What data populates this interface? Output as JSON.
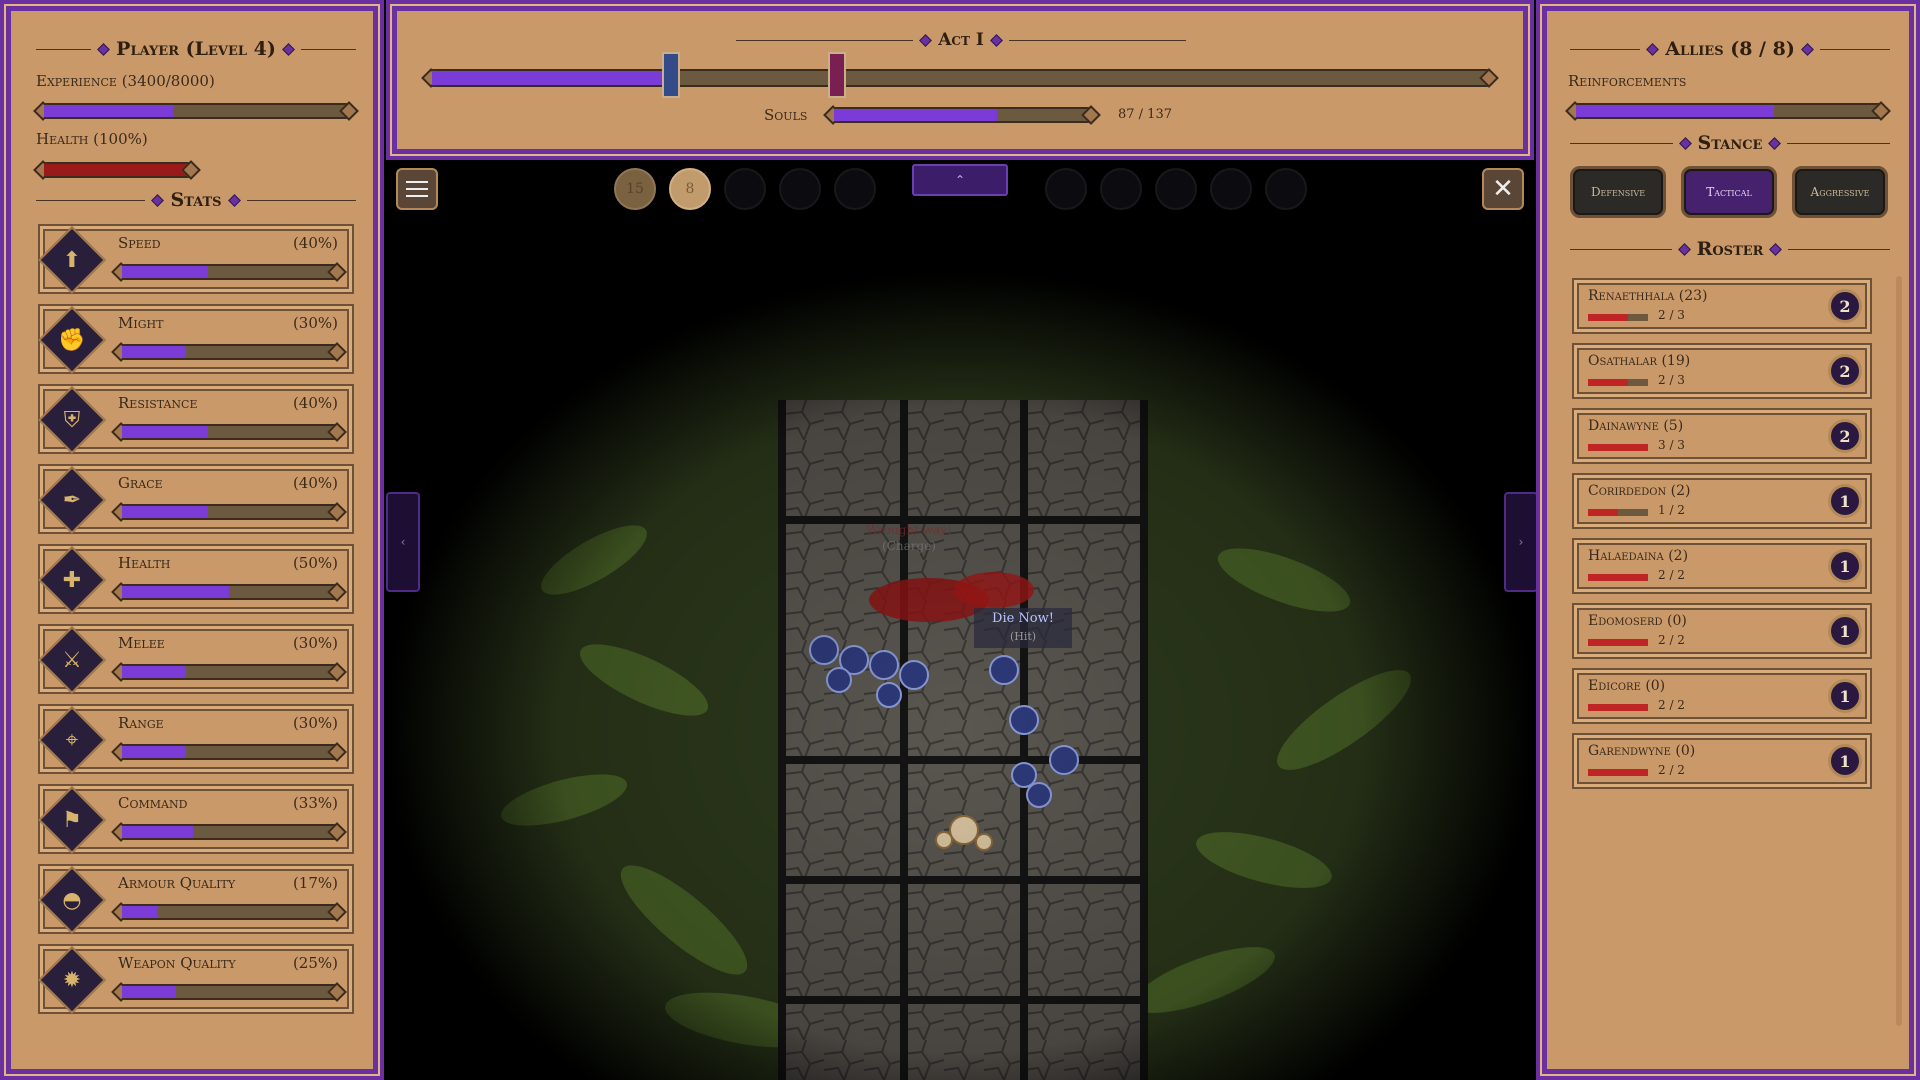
{
  "player": {
    "title": "Player (Level 4)",
    "experience_label": "Experience (3400/8000)",
    "experience_fraction": 0.425,
    "health_label": "Health (100%)",
    "health_fraction": 1.0
  },
  "stats": {
    "title": "Stats",
    "items": [
      {
        "name": "Speed",
        "pct": "(40%)",
        "value": 0.4,
        "icon": "boot-icon"
      },
      {
        "name": "Might",
        "pct": "(30%)",
        "value": 0.3,
        "icon": "flexed-arm-icon"
      },
      {
        "name": "Resistance",
        "pct": "(40%)",
        "value": 0.4,
        "icon": "shield-icon"
      },
      {
        "name": "Grace",
        "pct": "(40%)",
        "value": 0.4,
        "icon": "winged-feather-icon"
      },
      {
        "name": "Health",
        "pct": "(50%)",
        "value": 0.5,
        "icon": "cross-icon"
      },
      {
        "name": "Melee",
        "pct": "(30%)",
        "value": 0.3,
        "icon": "crossed-swords-icon"
      },
      {
        "name": "Range",
        "pct": "(30%)",
        "value": 0.3,
        "icon": "crosshair-icon"
      },
      {
        "name": "Command",
        "pct": "(33%)",
        "value": 0.33,
        "icon": "banner-icon"
      },
      {
        "name": "Armour Quality",
        "pct": "(17%)",
        "value": 0.17,
        "icon": "helmet-icon"
      },
      {
        "name": "Weapon Quality",
        "pct": "(25%)",
        "value": 0.25,
        "icon": "star-burst-icon"
      }
    ]
  },
  "act": {
    "title": "Act I",
    "progress_fraction": 0.23,
    "souls_label": "Souls",
    "souls_value": "87 / 137",
    "souls_fraction": 0.635
  },
  "toolbar": {
    "menu_icon": "hamburger-icon",
    "close_icon": "close-icon",
    "expand_icon": "chevron-up-icon",
    "slots_left": [
      "15",
      "8",
      "",
      "",
      ""
    ],
    "slots_right": [
      "",
      "",
      "",
      "",
      ""
    ]
  },
  "battlefield": {
    "shout_one": "Wrought way!",
    "shout_one_sub": "(Charge)",
    "shout_two": "Die Now!",
    "shout_two_sub": "(Hit)"
  },
  "allies": {
    "title": "Allies (8 / 8)",
    "reinforcements_label": "Reinforcements",
    "reinforcements_fraction": 0.65,
    "stance_title": "Stance",
    "stances": [
      "Defensive",
      "Tactical",
      "Aggressive"
    ],
    "active_stance": "Tactical",
    "roster_title": "Roster",
    "roster": [
      {
        "name": "Renaethhala (23)",
        "hp": "2 / 3",
        "hp_fraction": 0.67,
        "badge": "2"
      },
      {
        "name": "Osathalar (19)",
        "hp": "2 / 3",
        "hp_fraction": 0.67,
        "badge": "2"
      },
      {
        "name": "Dainawyne (5)",
        "hp": "3 / 3",
        "hp_fraction": 1.0,
        "badge": "2"
      },
      {
        "name": "Corirdedon (2)",
        "hp": "1 / 2",
        "hp_fraction": 0.5,
        "badge": "1"
      },
      {
        "name": "Halaedaina (2)",
        "hp": "2 / 2",
        "hp_fraction": 1.0,
        "badge": "1"
      },
      {
        "name": "Edomoserd (0)",
        "hp": "2 / 2",
        "hp_fraction": 1.0,
        "badge": "1"
      },
      {
        "name": "Edicore (0)",
        "hp": "2 / 2",
        "hp_fraction": 1.0,
        "badge": "1"
      },
      {
        "name": "Garendwyne (0)",
        "hp": "2 / 2",
        "hp_fraction": 1.0,
        "badge": "1"
      }
    ]
  },
  "colors": {
    "accent": "#7b3bd6",
    "frame": "#6a2fa0",
    "panel": "#c9996a",
    "health": "#9a1a1a"
  }
}
